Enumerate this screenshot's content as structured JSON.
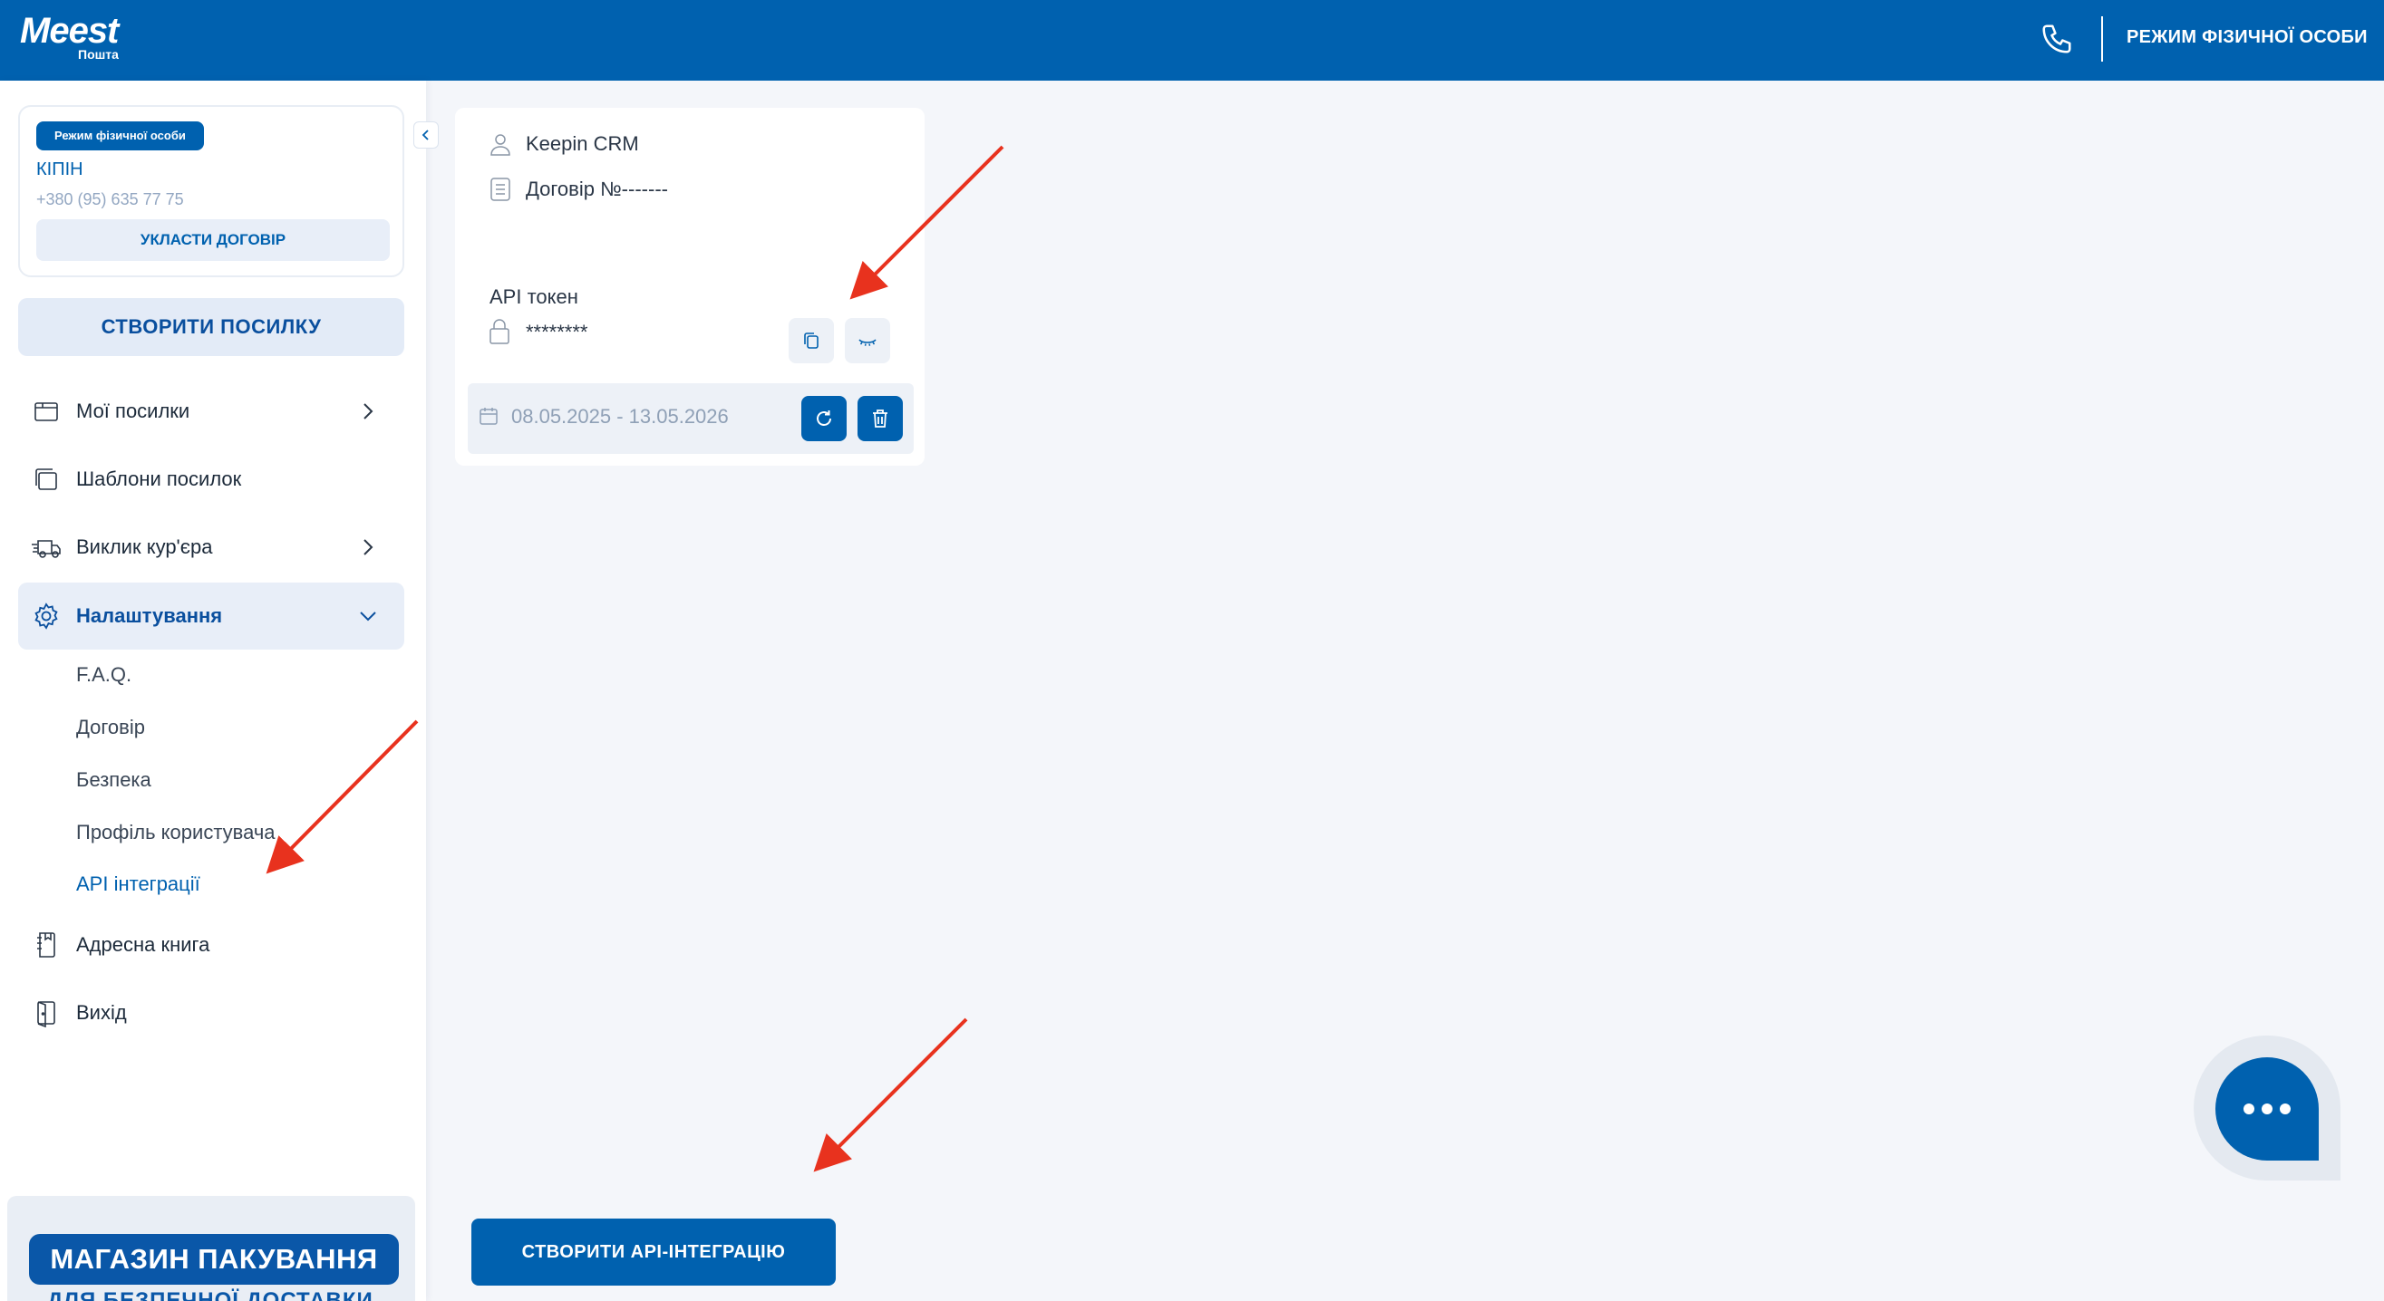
{
  "header": {
    "logo_main": "Meest",
    "logo_sub": "Пошта",
    "mode_link": "РЕЖИМ ФІЗИЧНОЇ ОСОБИ"
  },
  "profile": {
    "mode_badge": "Режим фізичної особи",
    "name": "КІПІН",
    "phone": "+380 (95) 635 77 75",
    "contract_button": "УКЛАСТИ ДОГОВІР"
  },
  "sidebar": {
    "create_parcel": "СТВОРИТИ ПОСИЛКУ",
    "items": [
      {
        "label": "Мої посилки",
        "icon": "parcel-icon"
      },
      {
        "label": "Шаблони посилок",
        "icon": "templates-icon"
      },
      {
        "label": "Виклик кур'єра",
        "icon": "courier-truck-icon"
      },
      {
        "label": "Налаштування",
        "icon": "gear-icon"
      },
      {
        "label": "Адресна книга",
        "icon": "address-book-icon"
      },
      {
        "label": "Вихід",
        "icon": "exit-icon"
      }
    ],
    "settings_sub": [
      {
        "label": "F.A.Q."
      },
      {
        "label": "Договір"
      },
      {
        "label": "Безпека"
      },
      {
        "label": "Профіль користувача"
      },
      {
        "label": "API інтеграції"
      }
    ],
    "promo_title": "МАГАЗИН ПАКУВАННЯ",
    "promo_subtitle": "ДЛЯ БЕЗПЕЧНОЇ ДОСТАВКИ"
  },
  "integration_card": {
    "name": "Keepin CRM",
    "contract": "Договір №-------",
    "token_label": "API токен",
    "token_value": "********",
    "date_range": "08.05.2025 - 13.05.2026"
  },
  "main": {
    "create_api_button": "СТВОРИТИ API-ІНТЕГРАЦІЮ"
  },
  "colors": {
    "brand": "#0061af",
    "annotation_arrow": "#e8321e"
  }
}
